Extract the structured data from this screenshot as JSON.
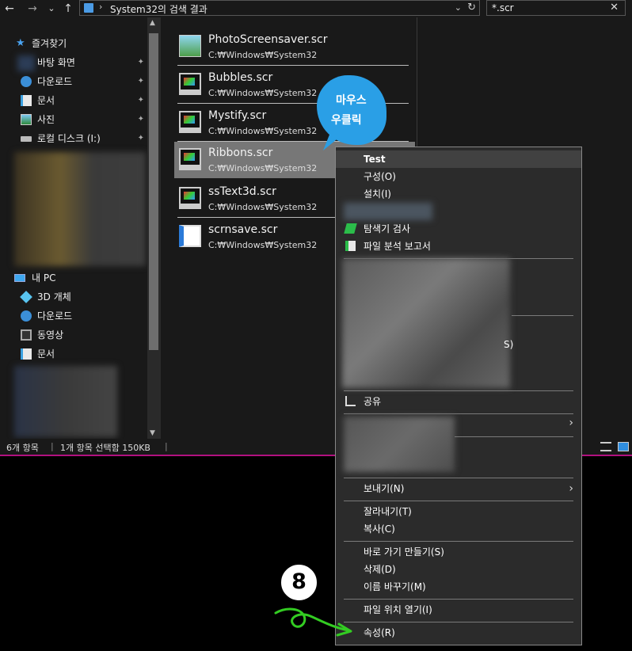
{
  "topbar": {
    "back_glyph": "←",
    "forward_glyph": "→",
    "recent_glyph": "⌄",
    "up_glyph": "↑",
    "breadcrumb_sep": "›",
    "path": "System32의 검색 결과",
    "search_value": "*.scr",
    "clear_glyph": "✕",
    "refresh_glyph": "↻",
    "dropdown_glyph": "⌄"
  },
  "sidebar": {
    "quick_access": "즐겨찾기",
    "items_quick": [
      "바탕 화면",
      "다운로드",
      "문서",
      "사진",
      "로컬 디스크 (I:)"
    ],
    "this_pc": "내 PC",
    "items_pc": [
      "3D 개체",
      "다운로드",
      "동영상",
      "문서"
    ],
    "pin_glyph": "📌"
  },
  "files": [
    {
      "name": "PhotoScreensaver.scr",
      "path": "C:₩Windows₩System32",
      "icon": "photo-screensaver-icon"
    },
    {
      "name": "Bubbles.scr",
      "path": "C:₩Windows₩System32",
      "icon": "screensaver-icon"
    },
    {
      "name": "Mystify.scr",
      "path": "C:₩Windows₩System32",
      "icon": "screensaver-icon"
    },
    {
      "name": "Ribbons.scr",
      "path": "C:₩Windows₩System32",
      "icon": "screensaver-icon",
      "selected": true
    },
    {
      "name": "ssText3d.scr",
      "path": "C:₩Windows₩System32",
      "icon": "screensaver-icon"
    },
    {
      "name": "scrnsave.scr",
      "path": "C:₩Windows₩System32",
      "icon": "blank-screensaver-icon"
    }
  ],
  "status": {
    "count": "6개 항목",
    "selection": "1개 항목 선택함 150KB"
  },
  "balloon": {
    "line1": "마우스",
    "line2": "우클릭"
  },
  "context_menu": {
    "test": "Test",
    "configure": "구성(O)",
    "install": "설치(I)",
    "explorer_scan": "탐색기 검사",
    "file_report": "파일 분석 보고서",
    "partial_s": "S)",
    "share": "공유",
    "send_to": "보내기(N)",
    "cut": "잘라내기(T)",
    "copy": "복사(C)",
    "create_shortcut": "바로 가기 만들기(S)",
    "delete": "삭제(D)",
    "rename": "이름 바꾸기(M)",
    "open_location": "파일 위치 열기(I)",
    "properties": "속성(R)",
    "submenu_glyph": "›"
  },
  "annotation": {
    "step_number": "8"
  },
  "colors": {
    "accent_magenta": "#b1117f",
    "balloon_blue": "#2a9fe6",
    "arrow_green": "#33cc22",
    "selection_gray": "#777777"
  }
}
